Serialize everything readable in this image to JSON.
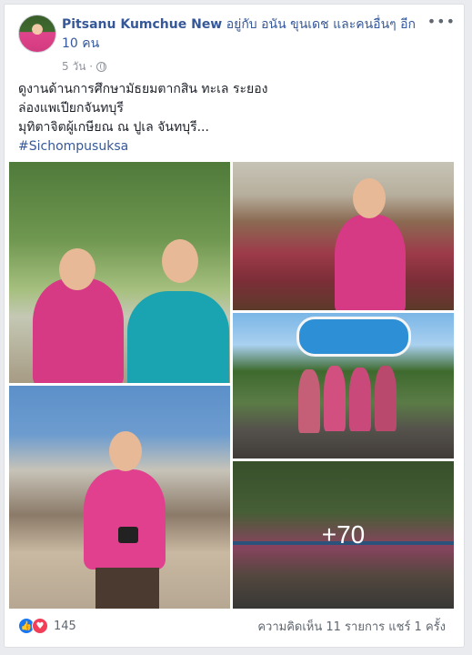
{
  "post": {
    "author": "Pitsanu Kumchue New",
    "with_text": "อยู่กับ อนัน ขุนเดช และคนอื่นๆ อีก 10 คน",
    "time": "5 วัน ·",
    "more_icon": "ellipsis-icon",
    "privacy_icon": "globe-icon",
    "lines": [
      "ดูงานด้านการศึกษามัธยมตากสิน ทะเล ระยอง",
      "ล่องแพเปียกจันทบุรี",
      "มุทิตาจิตผู้เกษียณ ณ ปูเล จันทบุรี..."
    ],
    "hashtag": "#Sichompusuksa"
  },
  "photos": {
    "more_count": "+70"
  },
  "footer": {
    "reactions_count": "145",
    "stats": "ความคิดเห็น 11 รายการ  แชร์ 1 ครั้ง",
    "like_icon": "like-icon",
    "love_icon": "heart-icon"
  },
  "colors": {
    "link": "#365899",
    "like": "#1877f2",
    "love": "#f33e58"
  }
}
